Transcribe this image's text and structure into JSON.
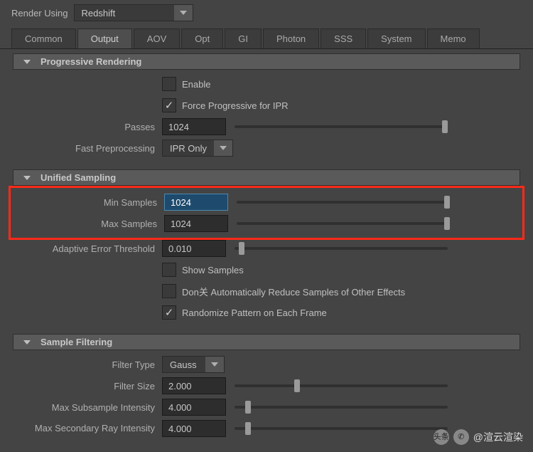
{
  "header": {
    "render_using_label": "Render Using",
    "render_using_value": "Redshift"
  },
  "tabs": {
    "items": [
      "Common",
      "Output",
      "AOV",
      "Opt",
      "GI",
      "Photon",
      "SSS",
      "System",
      "Memo"
    ],
    "active": "Output"
  },
  "progressive": {
    "title": "Progressive Rendering",
    "enable_label": "Enable",
    "enable_checked": false,
    "force_label": "Force Progressive for IPR",
    "force_checked": true,
    "passes_label": "Passes",
    "passes_value": "1024",
    "fast_label": "Fast Preprocessing",
    "fast_value": "IPR Only"
  },
  "unified": {
    "title": "Unified Sampling",
    "min_label": "Min Samples",
    "min_value": "1024",
    "max_label": "Max Samples",
    "max_value": "1024",
    "threshold_label": "Adaptive Error Threshold",
    "threshold_value": "0.010",
    "show_label": "Show Samples",
    "show_checked": false,
    "dont_reduce_label": "Don关 Automatically Reduce Samples of Other Effects",
    "dont_reduce_checked": false,
    "randomize_label": "Randomize Pattern on Each Frame",
    "randomize_checked": true
  },
  "filtering": {
    "title": "Sample Filtering",
    "type_label": "Filter Type",
    "type_value": "Gauss",
    "size_label": "Filter Size",
    "size_value": "2.000",
    "subsample_label": "Max Subsample Intensity",
    "subsample_value": "4.000",
    "secondary_label": "Max Secondary Ray Intensity",
    "secondary_value": "4.000"
  },
  "watermark": {
    "source": "头条",
    "handle": "@渲云渲染"
  }
}
